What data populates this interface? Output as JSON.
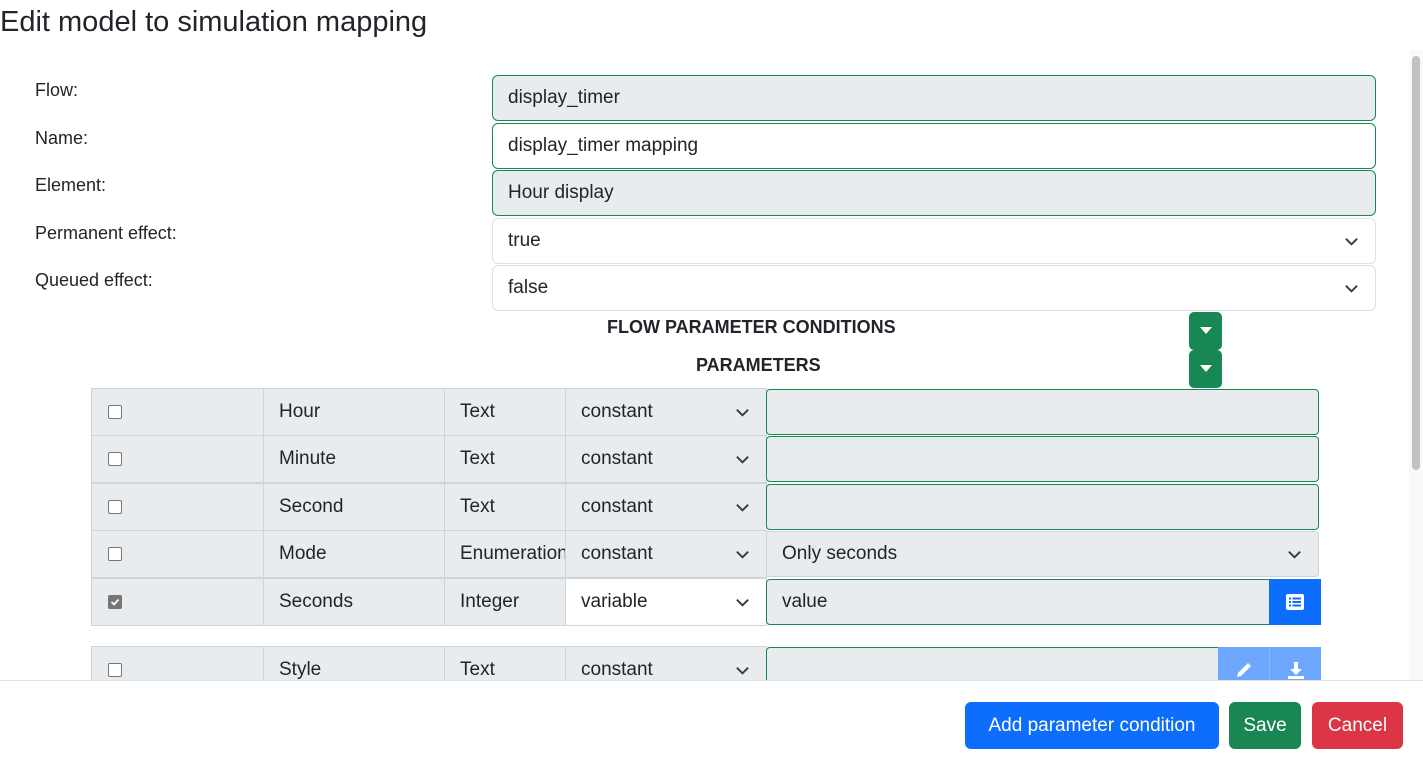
{
  "dialog": {
    "title": "Edit model to simulation mapping"
  },
  "form": {
    "flow": {
      "label": "Flow:",
      "value": "display_timer"
    },
    "name": {
      "label": "Name:",
      "value": "display_timer mapping"
    },
    "element": {
      "label": "Element:",
      "value": "Hour display"
    },
    "permanent_effect": {
      "label": "Permanent effect:",
      "value": "true"
    },
    "queued_effect": {
      "label": "Queued effect:",
      "value": "false"
    }
  },
  "sections": {
    "flow_parameter_conditions": "FLOW PARAMETER CONDITIONS",
    "parameters": "PARAMETERS"
  },
  "parameters": [
    {
      "checked": false,
      "name": "Hour",
      "type": "Text",
      "mode": "constant",
      "value": ""
    },
    {
      "checked": false,
      "name": "Minute",
      "type": "Text",
      "mode": "constant",
      "value": ""
    },
    {
      "checked": false,
      "name": "Second",
      "type": "Text",
      "mode": "constant",
      "value": ""
    },
    {
      "checked": false,
      "name": "Mode",
      "type": "Enumeration",
      "mode": "constant",
      "value": "Only seconds"
    },
    {
      "checked": true,
      "name": "Seconds",
      "type": "Integer",
      "mode": "variable",
      "value": "value"
    },
    {
      "checked": false,
      "name": "Style",
      "type": "Text",
      "mode": "constant",
      "value": ""
    }
  ],
  "footer": {
    "add_condition": "Add parameter condition",
    "save": "Save",
    "cancel": "Cancel"
  },
  "colors": {
    "primary": "#0d6efd",
    "success": "#198754",
    "danger": "#dc3545"
  },
  "icons": {
    "select": "chevron-down-icon",
    "toggle": "caret-down-icon",
    "list": "list-icon",
    "edit": "pencil-icon",
    "download": "download-icon"
  }
}
